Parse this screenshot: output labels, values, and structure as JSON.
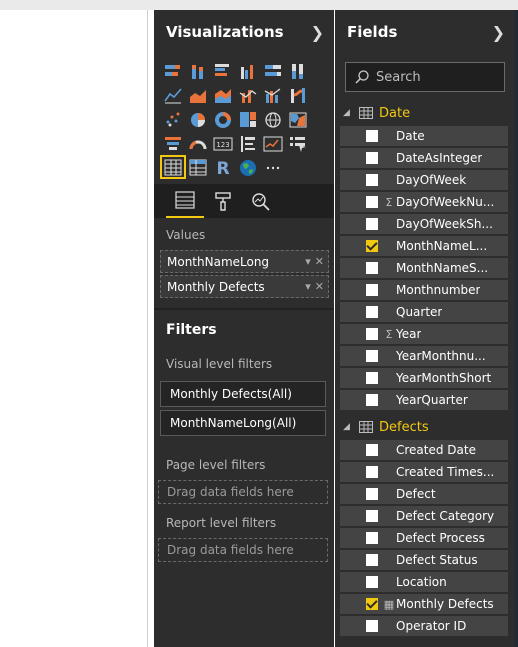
{
  "colors": {
    "accent": "#f2c811",
    "pane_bg": "#2d2d2d",
    "item_bg": "#444444"
  },
  "visualizations": {
    "title": "Visualizations",
    "expand_icon": "chevron-right-icon",
    "icons": [
      "stacked-bar-icon",
      "stacked-column-icon",
      "clustered-bar-icon",
      "clustered-column-icon",
      "100-bar-icon",
      "100-column-icon",
      "line-icon",
      "area-icon",
      "stacked-area-icon",
      "line-column-icon",
      "line-clustered-column-icon",
      "ribbon-icon",
      "scatter-icon",
      "pie-icon",
      "donut-icon",
      "treemap-icon",
      "map-icon",
      "filled-map-icon",
      "funnel-icon",
      "gauge-icon",
      "card-icon",
      "multirow-card-icon",
      "kpi-icon",
      "slicer-icon",
      "table-icon",
      "matrix-icon",
      "r-visual-icon",
      "globe-icon",
      "more-icon"
    ],
    "tabs": [
      "fields-tab-icon",
      "format-roller-icon",
      "analytics-icon"
    ],
    "values_label": "Values",
    "values": [
      "MonthNameLong",
      "Monthly Defects"
    ]
  },
  "filters": {
    "title": "Filters",
    "visual_level_label": "Visual level filters",
    "visual_level": [
      "Monthly Defects(All)",
      "MonthNameLong(All)"
    ],
    "page_level_label": "Page level filters",
    "page_drop": "Drag data fields here",
    "report_level_label": "Report level filters",
    "report_drop": "Drag data fields here"
  },
  "fields": {
    "title": "Fields",
    "search_placeholder": "Search",
    "tables": [
      {
        "name": "Date",
        "items": [
          {
            "label": "Date",
            "checked": false,
            "sigma": false
          },
          {
            "label": "DateAsInteger",
            "checked": false,
            "sigma": false
          },
          {
            "label": "DayOfWeek",
            "checked": false,
            "sigma": false
          },
          {
            "label": "DayOfWeekNu...",
            "checked": false,
            "sigma": true
          },
          {
            "label": "DayOfWeekSh...",
            "checked": false,
            "sigma": false
          },
          {
            "label": "MonthNameL...",
            "checked": true,
            "sigma": false
          },
          {
            "label": "MonthNameS...",
            "checked": false,
            "sigma": false
          },
          {
            "label": "Monthnumber",
            "checked": false,
            "sigma": false
          },
          {
            "label": "Quarter",
            "checked": false,
            "sigma": false
          },
          {
            "label": "Year",
            "checked": false,
            "sigma": true
          },
          {
            "label": "YearMonthnu...",
            "checked": false,
            "sigma": false
          },
          {
            "label": "YearMonthShort",
            "checked": false,
            "sigma": false
          },
          {
            "label": "YearQuarter",
            "checked": false,
            "sigma": false
          }
        ]
      },
      {
        "name": "Defects",
        "items": [
          {
            "label": "Created Date",
            "checked": false,
            "sigma": false
          },
          {
            "label": "Created Times...",
            "checked": false,
            "sigma": false
          },
          {
            "label": "Defect",
            "checked": false,
            "sigma": false
          },
          {
            "label": "Defect Category",
            "checked": false,
            "sigma": false
          },
          {
            "label": "Defect Process",
            "checked": false,
            "sigma": false
          },
          {
            "label": "Defect Status",
            "checked": false,
            "sigma": false
          },
          {
            "label": "Location",
            "checked": false,
            "sigma": false
          },
          {
            "label": "Monthly Defects",
            "checked": true,
            "sigma": false,
            "measure": true
          },
          {
            "label": "Operator ID",
            "checked": false,
            "sigma": false
          }
        ]
      }
    ]
  }
}
